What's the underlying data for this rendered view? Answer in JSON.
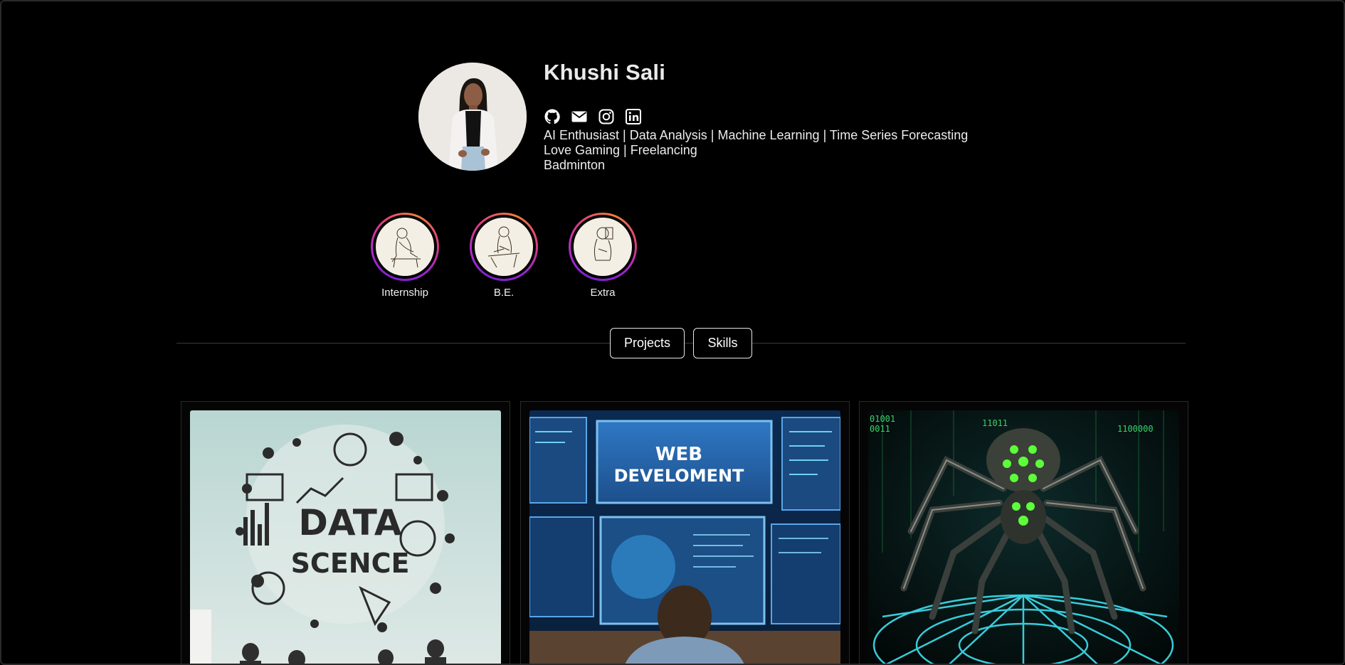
{
  "profile": {
    "name": "Khushi Sali",
    "bio": [
      "AI Enthusiast | Data Analysis | Machine Learning | Time Series Forecasting",
      "Love Gaming | Freelancing",
      "Badminton"
    ],
    "socials": [
      "github-icon",
      "email-icon",
      "instagram-icon",
      "linkedin-icon"
    ]
  },
  "highlights": [
    {
      "label": "Internship"
    },
    {
      "label": "B.E."
    },
    {
      "label": "Extra"
    }
  ],
  "tabs": {
    "projects_label": "Projects",
    "skills_label": "Skills"
  },
  "projects": [
    {
      "image_text_line1": "DATA",
      "image_text_line2": "SCENCE"
    },
    {
      "image_text_line1": "WEB",
      "image_text_line2": "DEVELOMENT"
    },
    {
      "image_code_left1": "01001",
      "image_code_left2": "0011",
      "image_code_mid": "11011",
      "image_code_right": "1100000"
    }
  ],
  "colors": {
    "background": "#000000",
    "ring_gradient_start": "#7a1fd1",
    "ring_gradient_end": "#f0803a",
    "text": "#ececec"
  }
}
